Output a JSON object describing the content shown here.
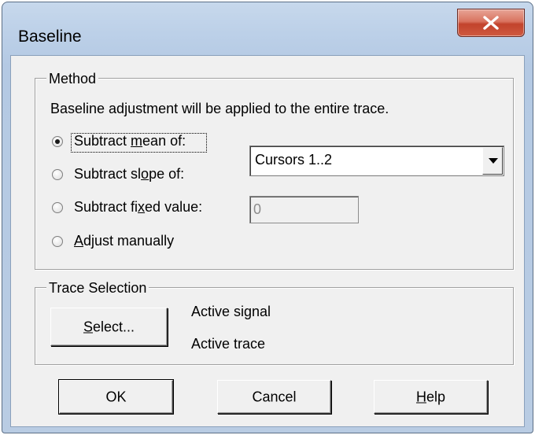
{
  "window": {
    "title": "Baseline"
  },
  "method": {
    "legend": "Method",
    "description": "Baseline adjustment will be applied to the entire trace.",
    "options": [
      {
        "pre": "Subtract ",
        "key": "m",
        "post": "ean of:",
        "selected": true
      },
      {
        "pre": "Subtract sl",
        "key": "o",
        "post": "pe of:",
        "selected": false
      },
      {
        "pre": "Subtract fi",
        "key": "x",
        "post": "ed value:",
        "selected": false
      },
      {
        "pre": "",
        "key": "A",
        "post": "djust manually",
        "selected": false
      }
    ],
    "range_select": {
      "value": "Cursors 1..2"
    },
    "fixed_value": {
      "value": "0"
    }
  },
  "trace_selection": {
    "legend": "Trace Selection",
    "select_button": {
      "key": "S",
      "post": "elect..."
    },
    "signal_label": "Active signal",
    "trace_label": "Active trace"
  },
  "buttons": {
    "ok": "OK",
    "cancel": "Cancel",
    "help": {
      "key": "H",
      "post": "elp"
    }
  },
  "colors": {
    "frame": "#b9cce3",
    "client": "#f0f0f0",
    "close": "#c7432c"
  },
  "icons": {
    "close": "close-icon",
    "dropdown": "chevron-down-icon"
  }
}
